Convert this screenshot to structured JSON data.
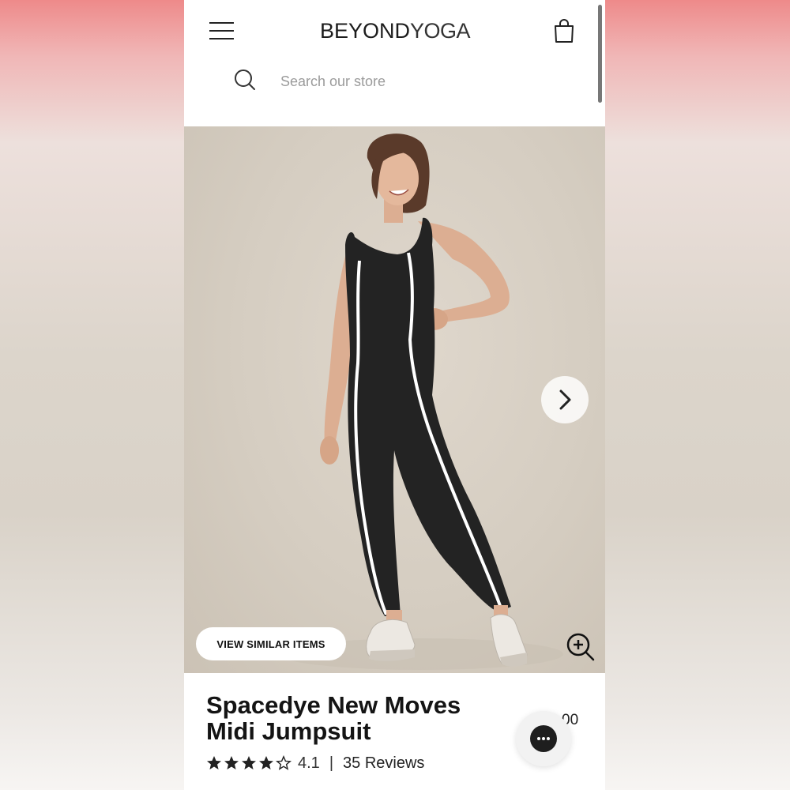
{
  "header": {
    "logo_bold": "BEYOND",
    "logo_light": "YOGA"
  },
  "search": {
    "placeholder": "Search our store"
  },
  "hero": {
    "similar_button": "VIEW SIMILAR ITEMS",
    "image_count_visible": 1
  },
  "product": {
    "title": "Spacedye New Moves Midi Jumpsuit",
    "price_partial": "00",
    "rating": 4.1,
    "rating_text": "4.1",
    "separator": "|",
    "reviews": "35 Reviews"
  },
  "colors": {
    "outfit": "#232323",
    "stripe": "#ffffff",
    "backdrop": "#d7cfc3",
    "skin": "#dcae92",
    "hair": "#5a3a2a"
  },
  "icons": [
    "menu-icon",
    "shopping-bag-icon",
    "search-icon",
    "chevron-right-icon",
    "zoom-in-icon",
    "star-icon",
    "chat-icon"
  ]
}
